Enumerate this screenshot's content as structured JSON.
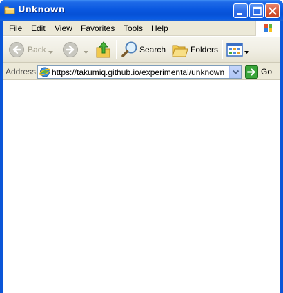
{
  "window": {
    "title": "Unknown",
    "controls": {
      "minimize": "minimize",
      "maximize": "maximize",
      "close": "close"
    }
  },
  "menubar": {
    "items": [
      {
        "label": "File"
      },
      {
        "label": "Edit"
      },
      {
        "label": "View"
      },
      {
        "label": "Favorites"
      },
      {
        "label": "Tools"
      },
      {
        "label": "Help"
      }
    ]
  },
  "toolbar": {
    "back_label": "Back",
    "search_label": "Search",
    "folders_label": "Folders",
    "icons": [
      "back-arrow-icon",
      "forward-arrow-icon",
      "up-folder-icon",
      "search-magnifier-icon",
      "folders-icon",
      "views-icon"
    ]
  },
  "addressbar": {
    "label": "Address",
    "value": "https://takumiq.github.io/experimental/unknown",
    "go_label": "Go"
  },
  "colors": {
    "titlebar": "#0a58e0",
    "chrome": "#ece9d8",
    "go_green": "#3aa53a",
    "close_red": "#d55a3b"
  }
}
